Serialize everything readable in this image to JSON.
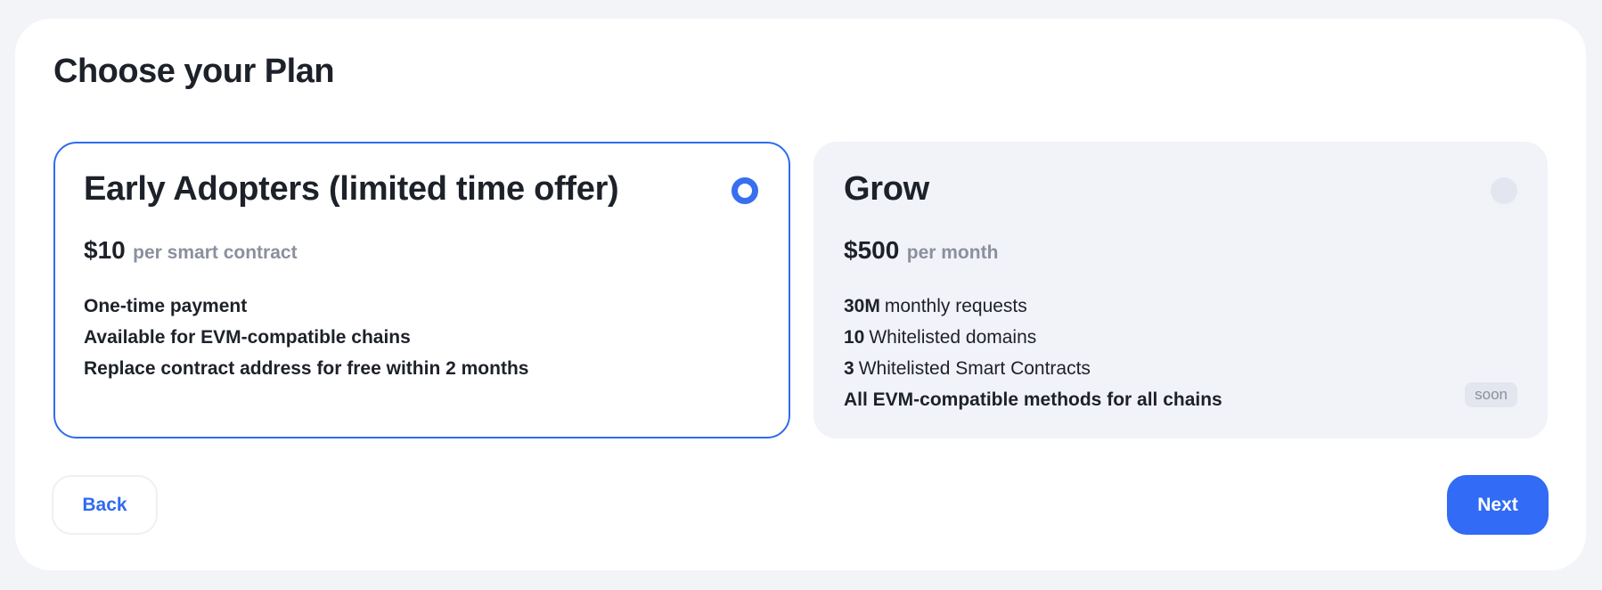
{
  "page": {
    "title": "Choose your Plan"
  },
  "plans": [
    {
      "name": "Early Adopters (limited time offer)",
      "price": "$10",
      "price_unit": "per smart contract",
      "selected": true,
      "features": [
        {
          "text": "One-time payment"
        },
        {
          "text": "Available for EVM-compatible chains"
        },
        {
          "text": "Replace contract address for free within 2 months"
        }
      ]
    },
    {
      "name": "Grow",
      "price": "$500",
      "price_unit": "per month",
      "selected": false,
      "features": [
        {
          "qty": "30M",
          "text": "monthly requests"
        },
        {
          "qty": "10",
          "text": "Whitelisted domains"
        },
        {
          "qty": "3",
          "text": "Whitelisted Smart Contracts"
        },
        {
          "text": "All EVM-compatible methods for all chains"
        }
      ],
      "badge": "soon"
    }
  ],
  "actions": {
    "back_label": "Back",
    "next_label": "Next"
  },
  "colors": {
    "accent": "#316bf6",
    "selected_border": "#2f6bef",
    "card_muted_bg": "#f1f3f8",
    "page_bg": "#f2f4f8",
    "muted_text": "#8a909e"
  }
}
